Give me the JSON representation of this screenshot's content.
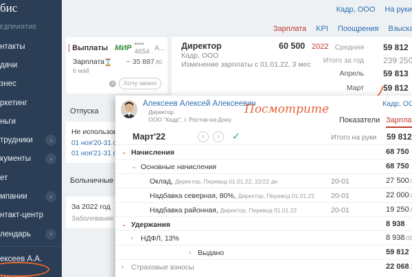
{
  "sidebar": {
    "logo": "бис",
    "org_sub": "ЕДПРИЯТИЕ",
    "items": [
      {
        "label": "нтакты",
        "chevron": false
      },
      {
        "label": "дачи",
        "chevron": false
      },
      {
        "label": "знес",
        "chevron": false
      },
      {
        "label": "ркетинг",
        "chevron": false
      },
      {
        "label": "ньги",
        "chevron": false
      },
      {
        "label": "трудники",
        "chevron": true
      },
      {
        "label": "кументы",
        "chevron": true
      },
      {
        "label": "ет",
        "chevron": false
      },
      {
        "label": "мпании",
        "chevron": true
      },
      {
        "label": "нтакт-центр",
        "chevron": false
      },
      {
        "label": "лендарь",
        "chevron": true
      }
    ],
    "user": "ексеев А.А.",
    "motivation": "тивация"
  },
  "topbar": {
    "company": "Кадр, ООО",
    "on_hand": "На руки"
  },
  "tabs": [
    {
      "label": "Зарплата",
      "active": true
    },
    {
      "label": "KPI",
      "active": false
    },
    {
      "label": "Поощрения",
      "active": false
    },
    {
      "label": "Взыскани",
      "active": false
    }
  ],
  "payments": {
    "title": "Выплаты",
    "card_brand": "МИР",
    "card_no": "•••• 4654",
    "card_more": "А...",
    "row_label": "Зарплата",
    "row_date": "6 май",
    "amount": "~ 35 887",
    "amount_kop": ",80",
    "advance_btn": "Хочу аванс"
  },
  "vacation": {
    "heading": "Отпуска",
    "title": "Не использова",
    "links": [
      "01 ноя'20-31 о",
      "01 ноя'21-31 о"
    ]
  },
  "sick": {
    "heading": "Больничные и п",
    "title": "За 2022 год",
    "subtitle": "Заболевание"
  },
  "director": {
    "title": "Директор",
    "amount": "60 500",
    "org": "Кадр, ООО",
    "change": "Изменение зарплаты с 01.01.22, 3 мес",
    "year": "2022",
    "stats": [
      {
        "label": "Средняя",
        "value": "59 812",
        "style": "dark-label"
      },
      {
        "label": "Итого за год",
        "value": "239 250",
        "style": "gray"
      },
      {
        "label": "Апрель",
        "value": "59 813",
        "style": "dark-label"
      },
      {
        "label": "Март",
        "value": "59 812",
        "style": "dark-label"
      }
    ]
  },
  "popup": {
    "name": "Алексеев Алексей Алексеевич",
    "role": "Директор",
    "org": "ООО \"Кадр\", г. Ростов-на-Дону",
    "hint": "Посмотрите",
    "company": "Кадр, ООО",
    "tabs": [
      {
        "label": "Показатели",
        "active": false
      },
      {
        "label": "Зарплата",
        "active": true
      }
    ],
    "period": "Март'22",
    "net_label": "Итого на руки",
    "net_value": "59 812",
    "rows": [
      {
        "label": "Начисления",
        "sub": "",
        "code": "",
        "value": "68 750",
        "kop": "",
        "bold": true,
        "indent": 0,
        "arrow": "red-down"
      },
      {
        "label": "Основные начисления",
        "sub": "",
        "code": "",
        "value": "68 750",
        "kop": "",
        "bold": true,
        "indent": 1,
        "arrow": "gray-down"
      },
      {
        "label": "Оклад,",
        "sub": "Директор, Перевод 01.01.22, 22/22 дн",
        "code": "20-01",
        "value": "27 500",
        "kop": ",00",
        "bold": false,
        "indent": 2,
        "arrow": ""
      },
      {
        "label": "Надбавка северная, 80%,",
        "sub": "Директор, Перевод 01.01.22",
        "code": "20-01",
        "value": "22 000",
        "kop": ",00",
        "bold": false,
        "indent": 2,
        "arrow": ""
      },
      {
        "label": "Надбавка районная,",
        "sub": "Директор, Перевод 01.01.22",
        "code": "20-01",
        "value": "19 250",
        "kop": ",00",
        "bold": false,
        "indent": 2,
        "arrow": ""
      },
      {
        "label": "Удержания",
        "sub": "",
        "code": "",
        "value": "8 938",
        "kop": "",
        "bold": true,
        "indent": 0,
        "arrow": "red-down"
      },
      {
        "label": "НДФЛ, 13%",
        "sub": "",
        "code": "",
        "value": "8 938",
        "kop": ",00",
        "bold": false,
        "indent": 1,
        "arrow": "gray-right"
      },
      {
        "label": "Выдано",
        "sub": "",
        "code": "",
        "value": "59 812",
        "kop": "",
        "bold": true,
        "indent": 3,
        "arrow": "gray-right"
      },
      {
        "label": "Страховые взносы",
        "sub": "",
        "code": "",
        "value": "22 068",
        "kop": ",7",
        "bold": true,
        "indent": 0,
        "arrow": "gray-right-muted"
      }
    ]
  },
  "colors": {
    "sidebar_bg": "#2b3e55",
    "accent_red": "#c0392b",
    "link_blue": "#2c6fb0",
    "highlight_orange": "#f06a2a",
    "mir_green": "#2e8b3a"
  }
}
